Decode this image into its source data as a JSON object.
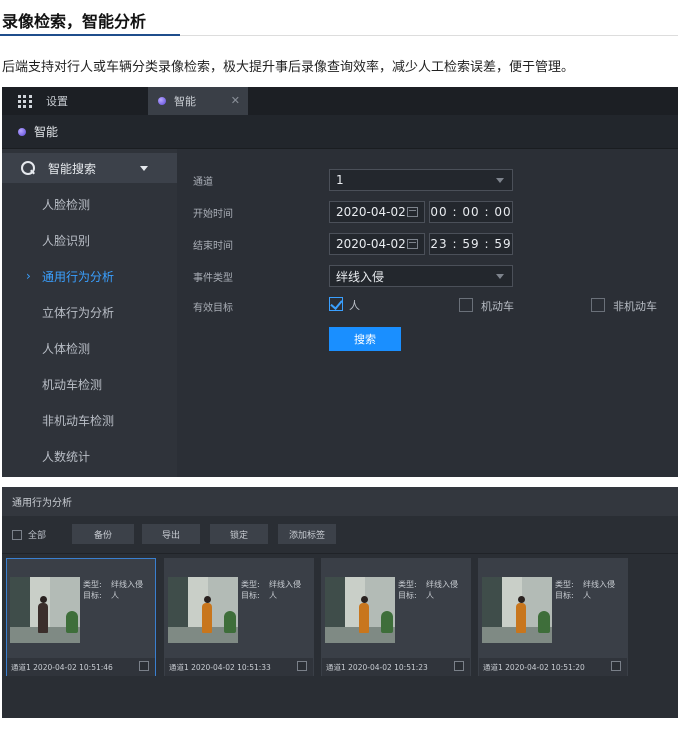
{
  "article": {
    "title": "录像检索，智能分析",
    "description": "后端支持对行人或车辆分类录像检索，极大提升事后录像查询效率，减少人工检索误差，便于管理。"
  },
  "tabs": [
    {
      "label": "设置"
    },
    {
      "label": "智能"
    }
  ],
  "header": {
    "title": "智能"
  },
  "sidebar": {
    "group_label": "智能搜索",
    "items": [
      {
        "label": "人脸检测"
      },
      {
        "label": "人脸识别"
      },
      {
        "label": "通用行为分析",
        "active": true
      },
      {
        "label": "立体行为分析"
      },
      {
        "label": "人体检测"
      },
      {
        "label": "机动车检测"
      },
      {
        "label": "非机动车检测"
      },
      {
        "label": "人数统计"
      }
    ]
  },
  "form": {
    "channel_label": "通道",
    "channel_value": "1",
    "start_label": "开始时间",
    "start_date": "2020-04-02",
    "start_h": "00",
    "start_m": "00",
    "start_s": "00",
    "end_label": "结束时间",
    "end_date": "2020-04-02",
    "end_h": "23",
    "end_m": "59",
    "end_s": "59",
    "event_label": "事件类型",
    "event_value": "绊线入侵",
    "target_label": "有效目标",
    "targets": [
      {
        "label": "人",
        "checked": true
      },
      {
        "label": "机动车",
        "checked": false
      },
      {
        "label": "非机动车",
        "checked": false
      }
    ],
    "search_button": "搜索"
  },
  "results": {
    "title": "通用行为分析",
    "select_all": "全部",
    "buttons": [
      "备份",
      "导出",
      "锁定",
      "添加标签"
    ],
    "type_key": "类型:",
    "target_key": "目标:",
    "type_value": "绊线入侵",
    "target_value": "人",
    "cards": [
      {
        "caption": "通道1 2020-04-02 10:51:46",
        "selected": true
      },
      {
        "caption": "通道1 2020-04-02 10:51:33",
        "selected": false
      },
      {
        "caption": "通道1 2020-04-02 10:51:23",
        "selected": false
      },
      {
        "caption": "通道1 2020-04-02 10:51:20",
        "selected": false
      }
    ]
  },
  "colors": {
    "accent": "#1a8fff",
    "active_menu": "#3aa0ff",
    "panel_bg": "#2b2f36"
  }
}
